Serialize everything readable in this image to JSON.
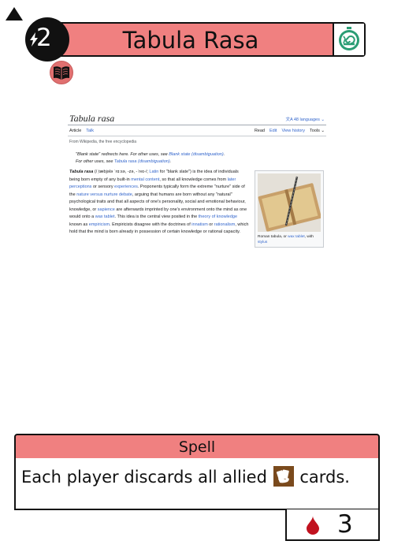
{
  "card": {
    "cost": "2",
    "title": "Tabula Rasa",
    "type": "Spell",
    "rules_before": "Each player discards all allied",
    "rules_after": "cards.",
    "stat_value": "3",
    "colors": {
      "band": "#f08080",
      "timer_green": "#2a9d74",
      "blood": "#c1121f",
      "cards_icon": "#7a4a1d"
    },
    "icons": [
      "lightning-bolt-icon",
      "snail-timer-icon",
      "open-book-icon",
      "cards-icon",
      "blood-drop-icon",
      "corner-triangle-icon"
    ]
  },
  "wiki": {
    "title": "Tabula rasa",
    "languages": "文A 48 languages ⌄",
    "tabs_left": [
      "Article",
      "Talk"
    ],
    "tabs_right": [
      "Read",
      "Edit",
      "View history",
      "Tools ⌄"
    ],
    "from_line": "From Wikipedia, the free encyclopedia",
    "hatnote_1a": "\"Blank state\" redirects here. For other uses, see ",
    "hatnote_1b": "Blank state (disambiguation)",
    "hatnote_2a": "For other uses, see ",
    "hatnote_2b": "Tabula rasa (disambiguation)",
    "body": [
      {
        "t": "Tabula rasa",
        "b": true
      },
      {
        "t": " (/ˌtæbjələ ˈrɑːsə, -zə, -ˈreɪ-/; "
      },
      {
        "t": "Latin",
        "l": true
      },
      {
        "t": " for \"blank slate\") is the idea of individuals being born empty of any built-in "
      },
      {
        "t": "mental content",
        "l": true
      },
      {
        "t": ", so that all knowledge comes from "
      },
      {
        "t": "later perceptions",
        "l": true
      },
      {
        "t": " or sensory "
      },
      {
        "t": "experiences",
        "l": true
      },
      {
        "t": ". Proponents typically form the extreme \"nurture\" side of the "
      },
      {
        "t": "nature versus nurture debate",
        "l": true
      },
      {
        "t": ", arguing that humans are born without any \"natural\" psychological traits and that all aspects of one's personality, social and emotional behaviour, knowledge, or "
      },
      {
        "t": "sapience",
        "l": true
      },
      {
        "t": " are afterwards imprinted by one's environment onto the mind as one would onto a "
      },
      {
        "t": "wax tablet",
        "l": true
      },
      {
        "t": ". This idea is the central view posited in the "
      },
      {
        "t": "theory of knowledge",
        "l": true
      },
      {
        "t": " known as "
      },
      {
        "t": "empiricism",
        "l": true
      },
      {
        "t": ". Empiricists disagree with the doctrines of "
      },
      {
        "t": "innatism",
        "l": true
      },
      {
        "t": " or "
      },
      {
        "t": "rationalism",
        "l": true
      },
      {
        "t": ", which hold that the mind is born already in possession of certain knowledge or rational capacity."
      }
    ],
    "caption_a": "Roman tabula, or ",
    "caption_b": "wax tablet",
    "caption_c": ", with ",
    "caption_d": "stylus"
  }
}
